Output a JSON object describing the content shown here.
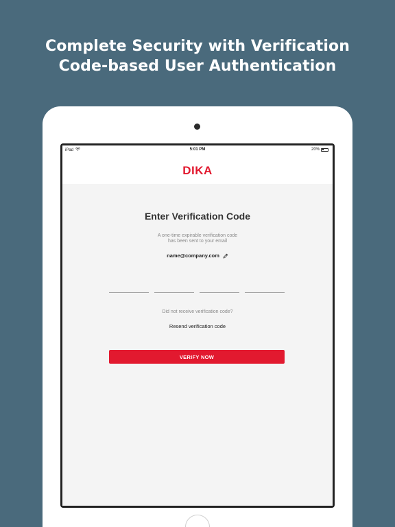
{
  "headline": {
    "line1": "Complete Security with Verification",
    "line2": "Code-based User Authentication"
  },
  "statusbar": {
    "device": "iPad",
    "time": "5:01 PM",
    "battery": "20%",
    "wifi_icon": "wifi-icon",
    "battery_icon": "battery-icon"
  },
  "app": {
    "logo": "DIKA",
    "brand_color": "#e2192f"
  },
  "verification": {
    "title": "Enter Verification Code",
    "description_line1": "A one-time expirable verification code",
    "description_line2": "has been sent to your email",
    "email": "name@company.com",
    "edit_icon": "pencil-icon",
    "code_fields": [
      "",
      "",
      "",
      ""
    ],
    "not_received": "Did not receive verification code?",
    "resend_label": "Resend verification code",
    "verify_label": "VERIFY NOW"
  },
  "colors": {
    "background": "#4a6a7c",
    "screen_bg": "#f4f4f4",
    "button": "#e2192f"
  }
}
